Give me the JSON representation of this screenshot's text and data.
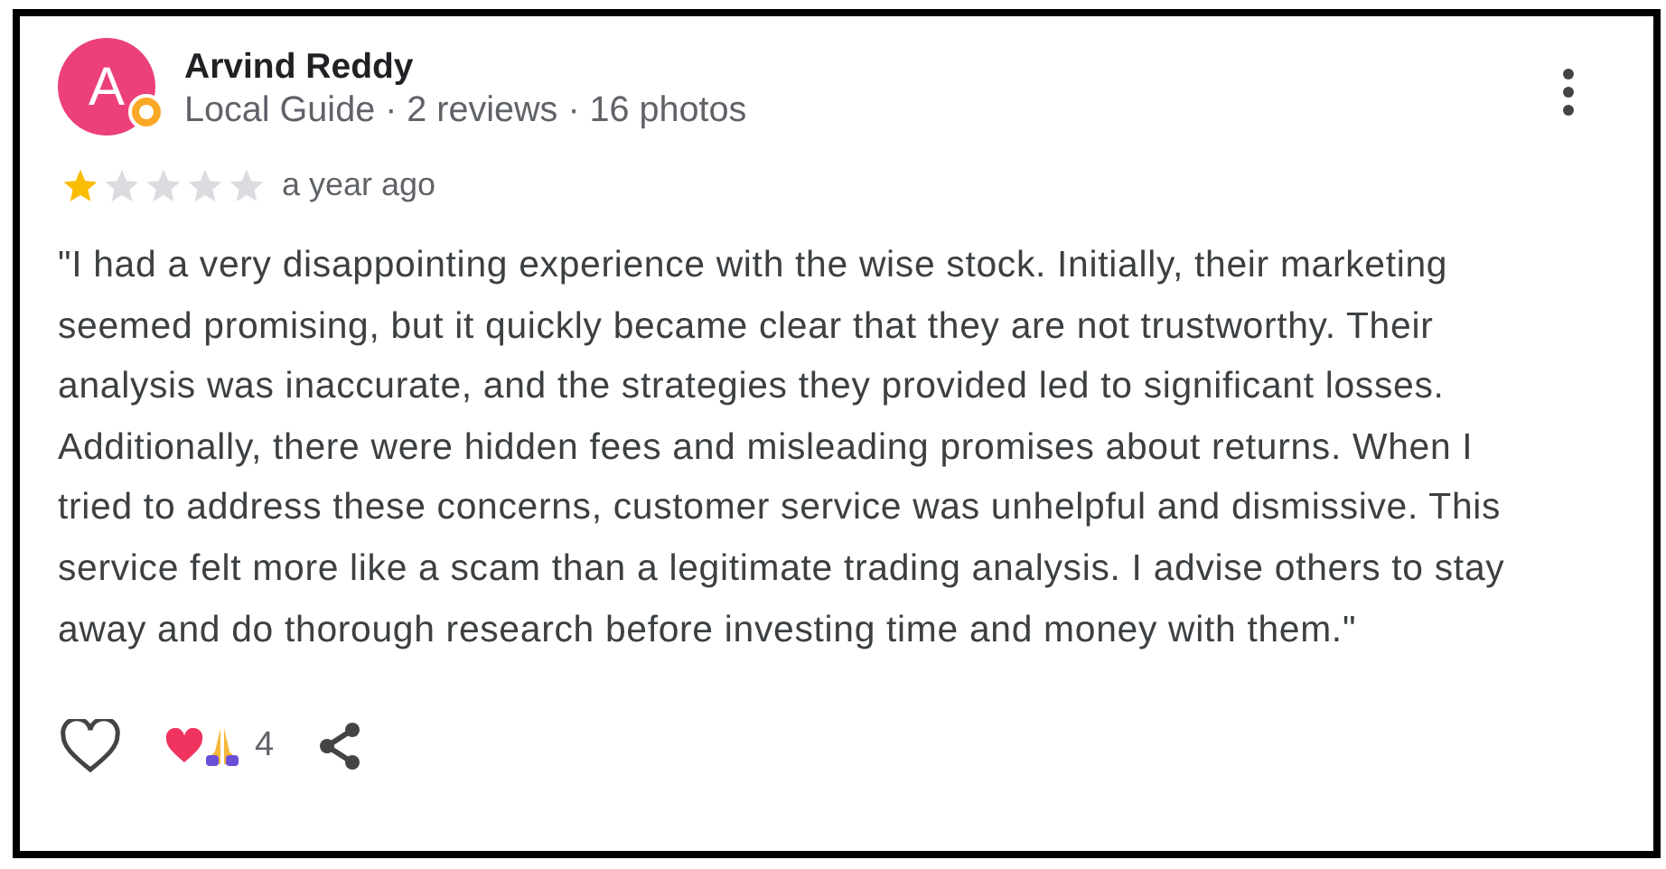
{
  "review": {
    "avatar_letter": "A",
    "name": "Arvind Reddy",
    "meta": "Local Guide · 2 reviews · 16 photos",
    "stars": 1,
    "time": "a year ago",
    "text": "\"I had a very disappointing experience with the wise stock. Initially, their marketing seemed promising, but it quickly became clear that they are not trustworthy. Their analysis was inaccurate, and the strategies they provided led to significant losses. Additionally, there were hidden fees and misleading promises about returns. When I tried to address these concerns, customer service was unhelpful and dismissive. This service felt more like a scam than a legitimate trading analysis. I advise others to stay away and do thorough research before investing time and money with them.\"",
    "liked": false,
    "reaction_count": "4"
  }
}
